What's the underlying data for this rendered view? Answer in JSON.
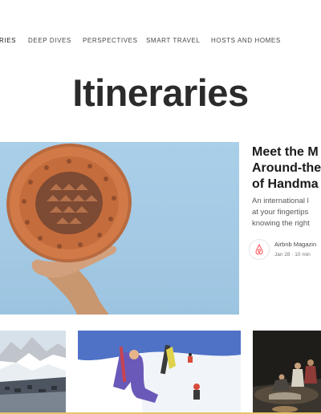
{
  "nav": {
    "items": [
      {
        "label": "RIES",
        "active": true
      },
      {
        "label": "DEEP DIVES",
        "active": false
      },
      {
        "label": "PERSPECTIVES",
        "active": false
      },
      {
        "label": "SMART TRAVEL",
        "active": false
      },
      {
        "label": "HOSTS AND HOMES",
        "active": false
      }
    ]
  },
  "page": {
    "title": "Itineraries"
  },
  "featured": {
    "title_lines": [
      "Meet the M",
      "Around-the",
      "of Handma"
    ],
    "desc_lines": [
      "An international l",
      "at your fingertips",
      "knowing the right"
    ],
    "author": "Airbnb Magazin",
    "meta": "Jan 28 · 10 min",
    "logo_icon": "airbnb-logo-icon",
    "brand_color": "#ff5a5f"
  }
}
